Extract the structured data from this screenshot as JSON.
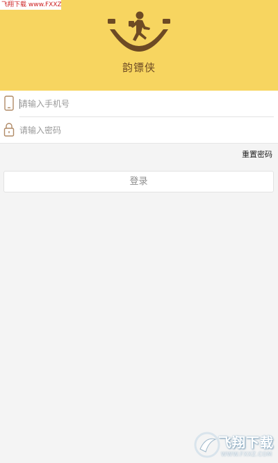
{
  "watermark_badge": "飞翔下载 www.FXXZ.com",
  "header": {
    "logo_icon": "smiley-runner-logo-icon",
    "app_name": "韵镖侠",
    "background": "#f7d560"
  },
  "form": {
    "phone": {
      "icon": "phone-icon",
      "placeholder": "请输入手机号",
      "value": ""
    },
    "password": {
      "icon": "lock-icon",
      "placeholder": "请输入密码",
      "value": ""
    }
  },
  "reset_password_label": "重置密码",
  "login_button_label": "登录",
  "watermark": {
    "icon": "fxxz-logo-icon",
    "title": "飞翔下载",
    "url": "WWW.FXXZ.COM"
  }
}
